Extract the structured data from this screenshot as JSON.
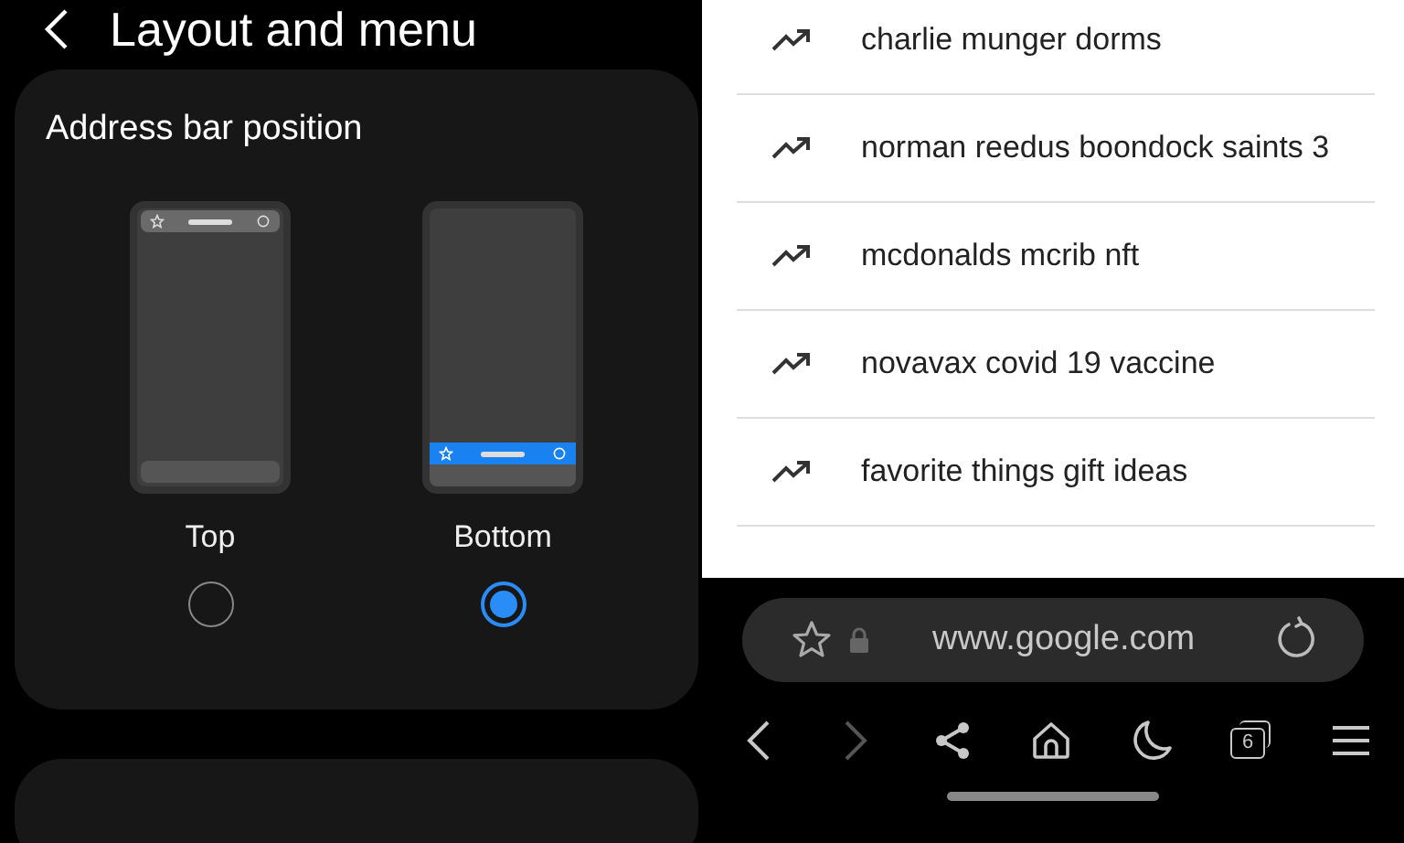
{
  "header": {
    "title": "Layout and menu"
  },
  "address_bar_position": {
    "title": "Address bar position",
    "options": [
      {
        "label": "Top",
        "kind": "top",
        "selected": false
      },
      {
        "label": "Bottom",
        "kind": "bottom",
        "selected": true
      }
    ]
  },
  "suggestions": [
    "charlie munger dorms",
    "norman reedus boondock saints 3",
    "mcdonalds mcrib nft",
    "novavax covid 19 vaccine",
    "favorite things gift ideas"
  ],
  "address_bar": {
    "url": "www.google.com"
  },
  "bottom_nav": [
    {
      "kind": "back",
      "disabled": false
    },
    {
      "kind": "forward",
      "disabled": true
    },
    {
      "kind": "share",
      "disabled": false
    },
    {
      "kind": "home",
      "disabled": false
    },
    {
      "kind": "night",
      "disabled": false
    },
    {
      "kind": "tabs",
      "disabled": false,
      "count": "6"
    },
    {
      "kind": "menu",
      "disabled": false
    }
  ]
}
